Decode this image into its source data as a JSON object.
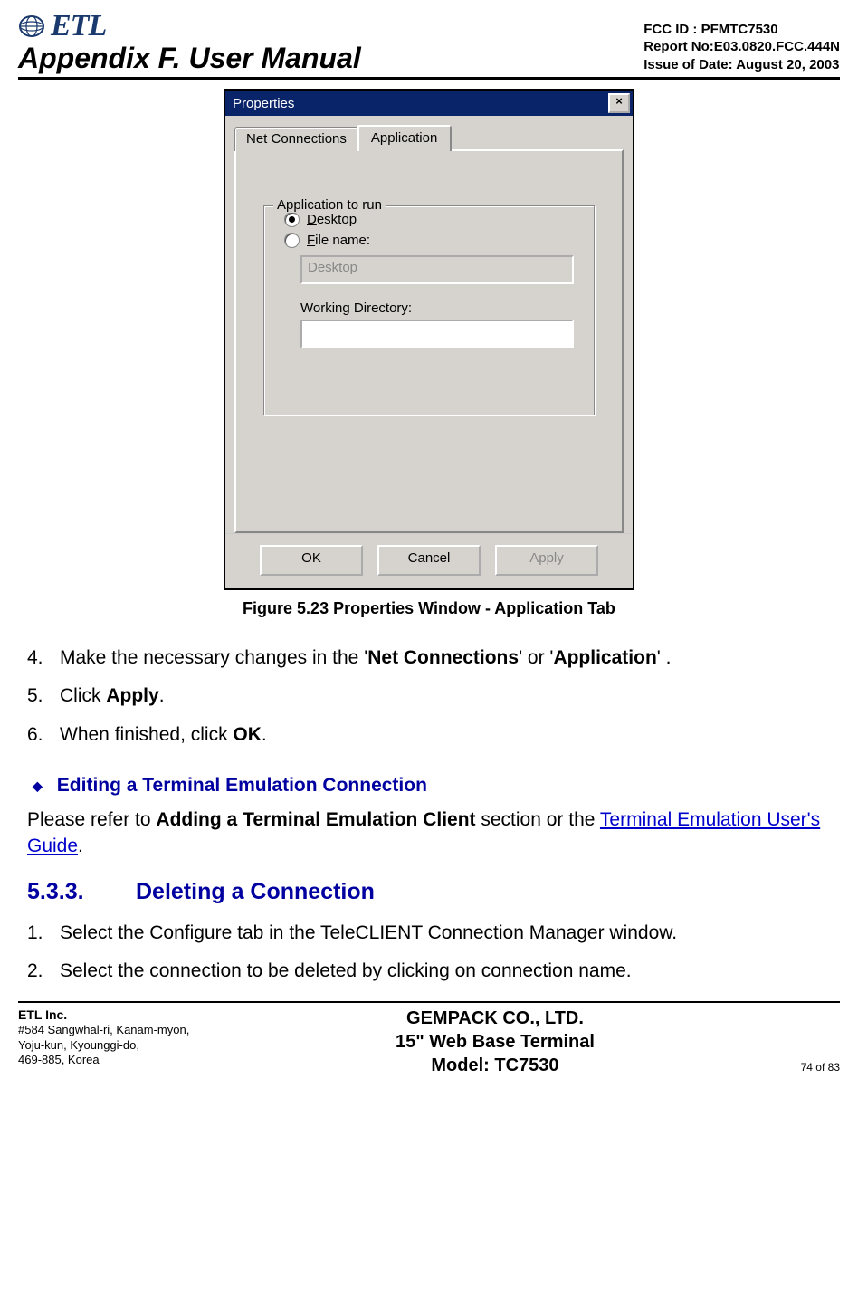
{
  "header": {
    "logo_text": "ETL",
    "appendix_title": "Appendix F. User Manual",
    "fcc_id": "FCC ID : PFMTC7530",
    "report_no": "Report No:E03.0820.FCC.444N",
    "issue_date": "Issue of Date: August 20, 2003"
  },
  "dialog": {
    "title": "Properties",
    "close_glyph": "×",
    "tabs": {
      "net": "Net Connections",
      "app": "Application"
    },
    "fieldset_legend": "Application to run",
    "radio_desktop_prefix": "D",
    "radio_desktop_rest": "esktop",
    "radio_filename_prefix": "F",
    "radio_filename_rest": "ile name:",
    "filename_value": "Desktop",
    "wd_label_prefix": "W",
    "wd_label_rest": "orking Directory:",
    "wd_value": "",
    "buttons": {
      "ok": "OK",
      "cancel": "Cancel",
      "apply": "Apply"
    }
  },
  "figure_caption": "Figure 5.23   Properties Window - Application Tab",
  "steps_a": [
    {
      "num": "4.",
      "pre": "Make the necessary changes in the '",
      "b1": "Net Connections",
      "mid": "'  or '",
      "b2": "Application",
      "post": "' ."
    },
    {
      "num": "5.",
      "pre": "Click ",
      "b1": "Apply",
      "mid": "",
      "b2": "",
      "post": "."
    },
    {
      "num": "6.",
      "pre": "When finished, click ",
      "b1": "OK",
      "mid": "",
      "b2": "",
      "post": "."
    }
  ],
  "subheading": "Editing a Terminal Emulation Connection",
  "refer": {
    "pre": "Please refer to ",
    "bold": "Adding a Terminal Emulation Client",
    "mid": " section or the ",
    "link": "Terminal Emulation User's Guide",
    "post": "."
  },
  "section": {
    "num": "5.3.3.",
    "title": "Deleting a Connection"
  },
  "steps_b": [
    {
      "num": "1.",
      "text": "Select the Configure tab in the TeleCLIENT Connection Manager window."
    },
    {
      "num": "2.",
      "text": "Select the connection to be deleted by clicking on connection name."
    }
  ],
  "footer": {
    "company": "ETL Inc.",
    "addr1": "#584 Sangwhal-ri, Kanam-myon,",
    "addr2": "Yoju-kun, Kyounggi-do,",
    "addr3": "469-885, Korea",
    "center1": "GEMPACK CO., LTD.",
    "center2": "15\" Web Base Terminal",
    "center3": "Model: TC7530",
    "page": "74 of 83"
  }
}
